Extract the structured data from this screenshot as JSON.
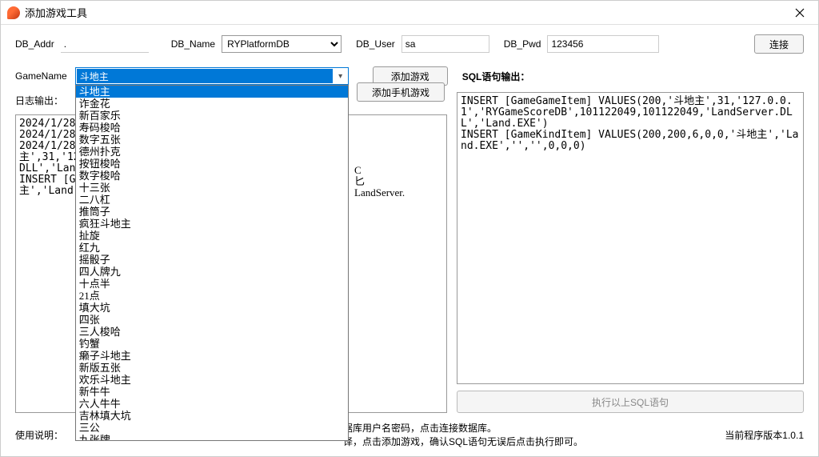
{
  "window": {
    "title": "添加游戏工具"
  },
  "db": {
    "addr_label": "DB_Addr",
    "addr_value": ".",
    "name_label": "DB_Name",
    "name_value": "RYPlatformDB",
    "user_label": "DB_User",
    "user_value": "sa",
    "pwd_label": "DB_Pwd",
    "pwd_value": "123456",
    "connect_label": "连接"
  },
  "game": {
    "name_label": "GameName",
    "selected": "斗地主",
    "add_game_label": "添加游戏",
    "add_mobile_label": "添加手机游戏",
    "options": [
      "斗地主",
      "诈金花",
      "新百家乐",
      "寿码梭哈",
      "数字五张",
      "德州扑克",
      "按钮梭哈",
      "数字梭哈",
      "十三张",
      "二八杠",
      "推筒子",
      "疯狂斗地主",
      "扯旋",
      "红九",
      "摇骰子",
      "四人牌九",
      "十点半",
      "21点",
      "填大坑",
      "四张",
      "三人梭哈",
      "钓蟹",
      "癞子斗地主",
      "新版五张",
      "欢乐斗地主",
      "新牛牛",
      "六人牛牛",
      "吉林填大坑",
      "三公",
      "九张牌"
    ]
  },
  "log": {
    "label": "日志输出：",
    "content": "2024/1/28\n2024/1/28\n2024/1/28\n主',31,'12\nDLL','Lan\nINSERT [G\n主','Land",
    "partial_visible": "C\n匕\nLandServer."
  },
  "sql": {
    "label": "SQL语句输出：",
    "content": "INSERT [GameGameItem] VALUES(200,'斗地主',31,'127.0.0.1','RYGameScoreDB',101122049,101122049,'LandServer.DLL','Land.EXE')\nINSERT [GameKindItem] VALUES(200,200,6,0,0,'斗地主','Land.EXE','','',0,0,0)",
    "exec_label": "执行以上SQL语句"
  },
  "footer": {
    "instruction_label": "使用说明：",
    "instruction_text": "据库用户名密码，点击连接数据库。",
    "instruction_text2": "译，点击添加游戏，确认SQL语句无误后点击执行即可。",
    "version": "当前程序版本1.0.1"
  }
}
